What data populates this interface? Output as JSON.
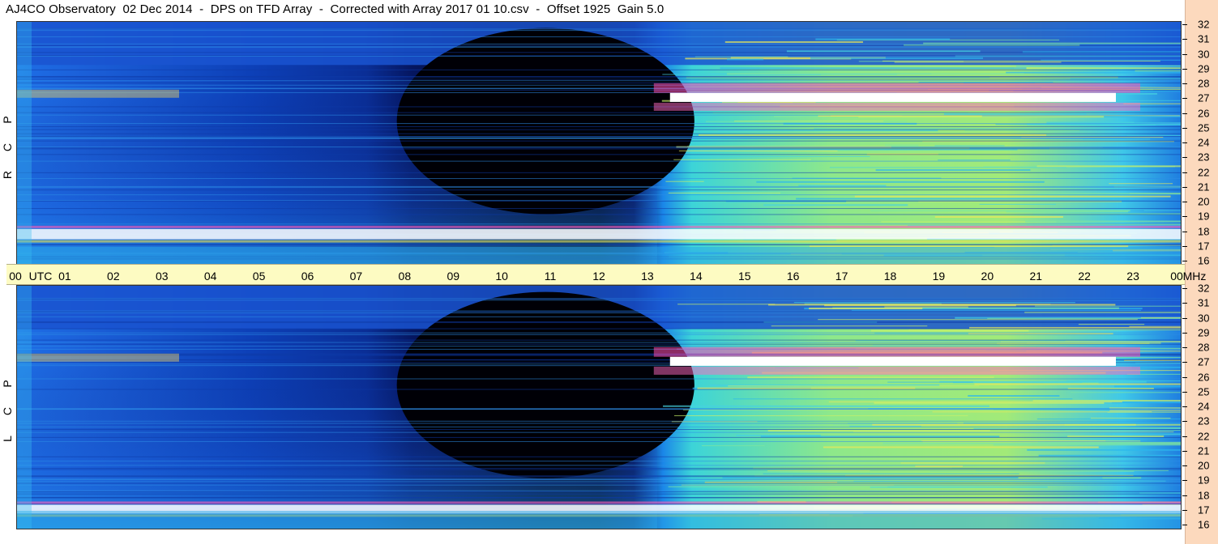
{
  "title": "AJ4CO Observatory  02 Dec 2014  -  DPS on TFD Array  -  Corrected with Array 2017 01 10.csv  -  Offset 1925  Gain 5.0",
  "colors": {
    "utc_bar": "#fdfbc2",
    "mhz_strip": "#fcd9bd",
    "night": "#000010",
    "low": "#0a3cc8",
    "mid": "#23c8f0",
    "high": "#b4f05a",
    "hot": "#ff3ca0",
    "sat": "#ffffff"
  },
  "chart_data": [
    {
      "type": "heatmap",
      "name": "RCP",
      "panel_label": [
        "R",
        "C",
        "P"
      ],
      "x_label_unit": "UTC",
      "x_ticks": [
        "00",
        "01",
        "02",
        "03",
        "04",
        "05",
        "06",
        "07",
        "08",
        "09",
        "10",
        "11",
        "12",
        "13",
        "14",
        "15",
        "16",
        "17",
        "18",
        "19",
        "20",
        "21",
        "22",
        "23",
        "00"
      ],
      "y_unit": "MHz",
      "y_ticks": [
        "32",
        "31",
        "30",
        "29",
        "28",
        "27",
        "26",
        "25",
        "24",
        "23",
        "22",
        "21",
        "20",
        "19",
        "18",
        "17",
        "16"
      ],
      "xlim": [
        0,
        24
      ],
      "ylim": [
        16,
        32
      ],
      "features": {
        "night_blackout_utc": [
          8,
          12.8
        ],
        "day_start_utc": 13.3,
        "strong_band_mhz": [
          26.8,
          27.3
        ],
        "strong_band_mhz_low": [
          17.5,
          18.2
        ]
      }
    },
    {
      "type": "heatmap",
      "name": "LCP",
      "panel_label": [
        "L",
        "C",
        "P"
      ],
      "x_label_unit": "UTC",
      "x_ticks": [
        "00",
        "01",
        "02",
        "03",
        "04",
        "05",
        "06",
        "07",
        "08",
        "09",
        "10",
        "11",
        "12",
        "13",
        "14",
        "15",
        "16",
        "17",
        "18",
        "19",
        "20",
        "21",
        "22",
        "23",
        "00"
      ],
      "y_unit": "MHz",
      "y_ticks": [
        "32",
        "31",
        "30",
        "29",
        "28",
        "27",
        "26",
        "25",
        "24",
        "23",
        "22",
        "21",
        "20",
        "19",
        "18",
        "17",
        "16"
      ],
      "xlim": [
        0,
        24
      ],
      "ylim": [
        16,
        32
      ],
      "features": {
        "night_blackout_utc": [
          8,
          12.8
        ],
        "day_start_utc": 13.3,
        "strong_band_mhz": [
          26.8,
          27.3
        ],
        "strong_band_mhz_low": [
          16.8,
          17.4
        ]
      }
    }
  ]
}
